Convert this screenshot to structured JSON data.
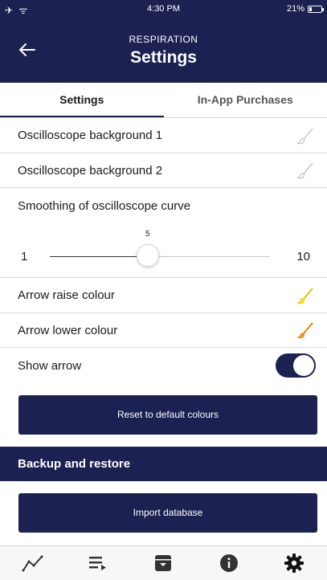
{
  "status_bar": {
    "left_icons": "✈ ᯤ",
    "time": "4:30 PM",
    "battery": "21%",
    "battery_level": 0.21
  },
  "header": {
    "back_icon": "arrow-left-icon",
    "subtitle": "RESPIRATION",
    "title": "Settings"
  },
  "tabs": [
    {
      "label": "Settings",
      "active": true
    },
    {
      "label": "In-App Purchases",
      "active": false
    }
  ],
  "rows": {
    "osc_bg1": {
      "label": "Oscilloscope background 1",
      "icon": "brush-icon",
      "color": "#ffffff"
    },
    "osc_bg2": {
      "label": "Oscilloscope background 2",
      "icon": "brush-icon",
      "color": "#ffffff"
    },
    "arrow_raise": {
      "label": "Arrow raise colour",
      "icon": "brush-icon",
      "color": "#f2ec1b"
    },
    "arrow_lower": {
      "label": "Arrow lower colour",
      "icon": "brush-icon",
      "color": "#f39a16"
    },
    "show_arrow": {
      "label": "Show arrow",
      "toggle_on": true
    }
  },
  "smoothing": {
    "label": "Smoothing of oscilloscope curve",
    "min_label": "1",
    "max_label": "10",
    "value_label": "5",
    "min": 1,
    "max": 10,
    "value": 5
  },
  "buttons": {
    "reset": "Reset to default colours",
    "import": "Import database"
  },
  "backup_section": {
    "title": "Backup and restore"
  },
  "colors": {
    "primary": "#1b2150",
    "divider": "#d8d8d8"
  },
  "bottom_nav": [
    {
      "icon": "chart-line-icon"
    },
    {
      "icon": "playlist-icon"
    },
    {
      "icon": "archive-icon"
    },
    {
      "icon": "info-icon"
    },
    {
      "icon": "gear-icon"
    }
  ]
}
